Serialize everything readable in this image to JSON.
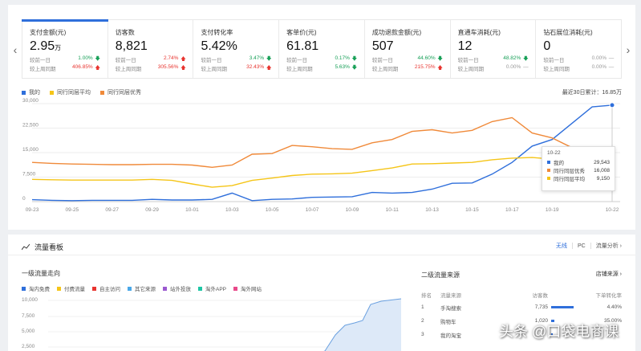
{
  "metrics": [
    {
      "name": "支付金额(元)",
      "value": "2.95",
      "unit": "万",
      "cmp1_label": "较前一日",
      "cmp1_value": "1.00%",
      "cmp1_dir": "down",
      "cmp2_label": "较上周同期",
      "cmp2_value": "406.85%",
      "cmp2_dir": "up",
      "active": true
    },
    {
      "name": "访客数",
      "value": "8,821",
      "unit": "",
      "cmp1_label": "较前一日",
      "cmp1_value": "2.74%",
      "cmp1_dir": "up",
      "cmp2_label": "较上周同期",
      "cmp2_value": "305.56%",
      "cmp2_dir": "up"
    },
    {
      "name": "支付转化率",
      "value": "5.42%",
      "unit": "",
      "cmp1_label": "较前一日",
      "cmp1_value": "3.47%",
      "cmp1_dir": "down",
      "cmp2_label": "较上周同期",
      "cmp2_value": "32.43%",
      "cmp2_dir": "up"
    },
    {
      "name": "客单价(元)",
      "value": "61.81",
      "unit": "",
      "cmp1_label": "较前一日",
      "cmp1_value": "0.17%",
      "cmp1_dir": "down",
      "cmp2_label": "较上周同期",
      "cmp2_value": "5.63%",
      "cmp2_dir": "down"
    },
    {
      "name": "成功退款金额(元)",
      "value": "507",
      "unit": "",
      "cmp1_label": "较前一日",
      "cmp1_value": "44.60%",
      "cmp1_dir": "down",
      "cmp2_label": "较上周同期",
      "cmp2_value": "215.75%",
      "cmp2_dir": "up"
    },
    {
      "name": "直通车消耗(元)",
      "value": "12",
      "unit": "",
      "cmp1_label": "较前一日",
      "cmp1_value": "48.82%",
      "cmp1_dir": "down",
      "cmp2_label": "较上周同期",
      "cmp2_value": "0.00%",
      "cmp2_dir": "flat"
    },
    {
      "name": "钻石展位消耗(元)",
      "value": "0",
      "unit": "",
      "cmp1_label": "较前一日",
      "cmp1_value": "0.00%",
      "cmp1_dir": "flat",
      "cmp2_label": "较上周同期",
      "cmp2_value": "0.00%",
      "cmp2_dir": "flat"
    }
  ],
  "arrows": {
    "prev": "‹",
    "next": "›"
  },
  "legend": [
    {
      "label": "我的",
      "color": "#2f6fdb"
    },
    {
      "label": "同行同层平均",
      "color": "#f5c518"
    },
    {
      "label": "同行同层优秀",
      "color": "#f08a3a"
    }
  ],
  "total_label": "最近30日累计：16.85万",
  "tooltip": {
    "date": "10-22",
    "rows": [
      {
        "name": "我的",
        "value": "29,543",
        "color": "#2f6fdb"
      },
      {
        "name": "同行同层优秀",
        "value": "16,008",
        "color": "#f08a3a"
      },
      {
        "name": "同行同层平均",
        "value": "9,150",
        "color": "#f5c518"
      }
    ]
  },
  "chart_data": {
    "type": "line",
    "x": [
      "09-23",
      "09-24",
      "09-25",
      "09-26",
      "09-27",
      "09-28",
      "09-29",
      "09-30",
      "10-01",
      "10-02",
      "10-03",
      "10-04",
      "10-05",
      "10-06",
      "10-07",
      "10-08",
      "10-09",
      "10-10",
      "10-11",
      "10-12",
      "10-13",
      "10-14",
      "10-15",
      "10-16",
      "10-17",
      "10-18",
      "10-19",
      "10-20",
      "10-21",
      "10-22"
    ],
    "x_tick_labels": [
      "09-23",
      "09-25",
      "09-27",
      "09-29",
      "10-01",
      "10-03",
      "10-05",
      "10-07",
      "10-09",
      "10-11",
      "10-13",
      "10-15",
      "10-17",
      "10-19",
      "10-22"
    ],
    "y_ticks": [
      "0",
      "7,500",
      "15,000",
      "22,500",
      "30,000"
    ],
    "ylim": [
      0,
      30000
    ],
    "series": [
      {
        "name": "我的",
        "color": "#2f6fdb",
        "values": [
          600,
          400,
          300,
          400,
          400,
          400,
          700,
          500,
          500,
          700,
          2600,
          300,
          700,
          800,
          1300,
          1400,
          1500,
          2800,
          2600,
          2800,
          3800,
          5600,
          5700,
          8400,
          12000,
          17000,
          19000,
          24000,
          29000,
          29543
        ]
      },
      {
        "name": "同行同层优秀",
        "color": "#f08a3a",
        "values": [
          12000,
          11700,
          11500,
          11400,
          11300,
          11300,
          11400,
          11400,
          11200,
          10500,
          11200,
          14500,
          14700,
          17200,
          16800,
          16200,
          16000,
          18000,
          19000,
          21500,
          22000,
          21000,
          21800,
          24500,
          25700,
          21000,
          19500,
          16500,
          16200,
          16008
        ]
      },
      {
        "name": "同行同层平均",
        "color": "#f5c518",
        "values": [
          6800,
          6700,
          6600,
          6600,
          6600,
          6600,
          6800,
          6500,
          5400,
          4400,
          4900,
          6500,
          7200,
          8000,
          8400,
          8500,
          8700,
          9500,
          10300,
          11500,
          11600,
          11800,
          12000,
          12800,
          13300,
          13500,
          13000,
          12000,
          9500,
          9150
        ]
      }
    ]
  },
  "traffic": {
    "title": "流量看板",
    "tab_wireless": "无线",
    "tab_pc": "PC",
    "analysis_link": "流量分析 ›",
    "l1_title": "一级流量走向",
    "l1_legend": [
      {
        "label": "淘内免费",
        "color": "#2f6fdb"
      },
      {
        "label": "付费流量",
        "color": "#f5c518"
      },
      {
        "label": "自主访问",
        "color": "#e8342f"
      },
      {
        "label": "其它来源",
        "color": "#4aa8e8"
      },
      {
        "label": "站外投放",
        "color": "#9b59d0"
      },
      {
        "label": "淘外APP",
        "color": "#1ec6a5"
      },
      {
        "label": "淘外网站",
        "color": "#e84a8a"
      }
    ],
    "l1_y": [
      "10,000",
      "7,500",
      "5,000",
      "2,500"
    ],
    "l2_title": "二级流量来源",
    "l2_link": "店铺来源 ›",
    "l2_headers": {
      "rank": "排名",
      "src": "流量来源",
      "visits": "访客数",
      "rate": "下单转化率"
    },
    "l2_rows": [
      {
        "rank": "1",
        "src": "手淘搜索",
        "visits": "7,735",
        "rate": "4.40%",
        "bar": 0.7
      },
      {
        "rank": "2",
        "src": "购物车",
        "visits": "1,020",
        "rate": "35.00%",
        "bar": 0.1
      },
      {
        "rank": "3",
        "src": "我的淘宝",
        "visits": "",
        "rate": "",
        "bar": 0.05
      }
    ]
  },
  "watermark": "头条 @口袋电商课"
}
